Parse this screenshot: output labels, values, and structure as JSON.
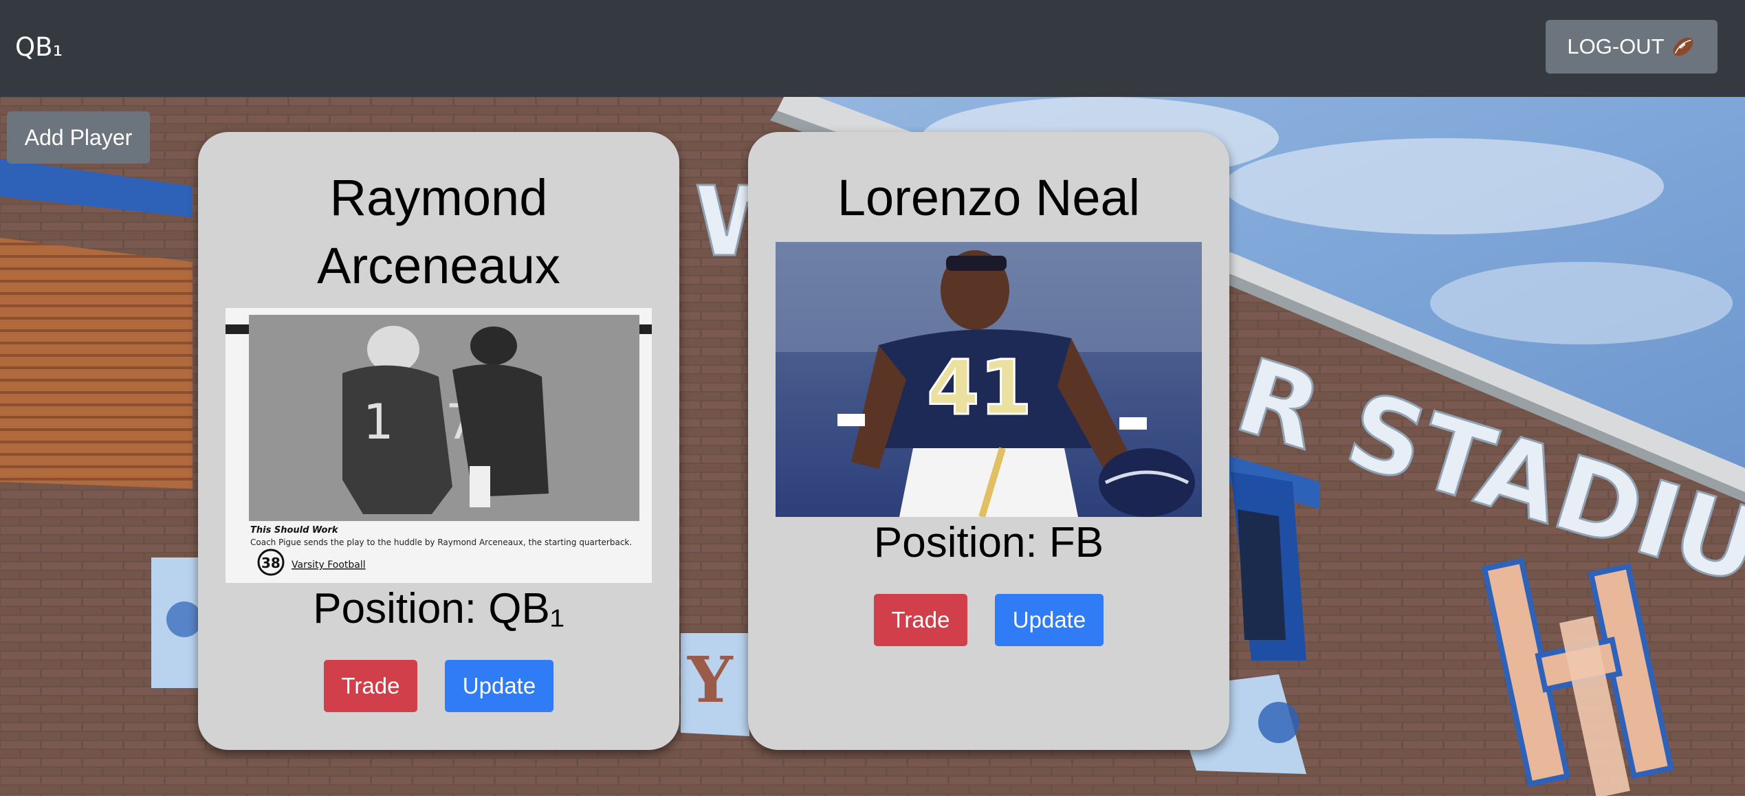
{
  "navbar": {
    "brand": "QB₁",
    "logout_label": "LOG-OUT",
    "logout_icon": "football-icon",
    "background_color": "#343a40"
  },
  "actions": {
    "add_player_label": "Add Player"
  },
  "background": {
    "signage": [
      "W",
      "R STADIUM",
      "Y"
    ],
    "sky_color": "#7ea6d8",
    "brick_color": "#6b5048"
  },
  "players": [
    {
      "name": "Raymond Arceneaux",
      "photo_caption_bold": "This Should Work",
      "photo_caption": "Coach Pigue sends the play to the huddle by Raymond Arceneaux, the starting quarterback.",
      "photo_page_number": "38",
      "photo_section": "Varsity Football",
      "position": "Position: QB₁",
      "trade_label": "Trade",
      "update_label": "Update"
    },
    {
      "name": "Lorenzo Neal",
      "photo_jersey_number": "41",
      "position": "Position: FB",
      "trade_label": "Trade",
      "update_label": "Update"
    }
  ],
  "colors": {
    "card_bg": "#d3d3d3",
    "trade": "#d1404a",
    "update": "#2f7cf6",
    "secondary": "#6c757d"
  }
}
